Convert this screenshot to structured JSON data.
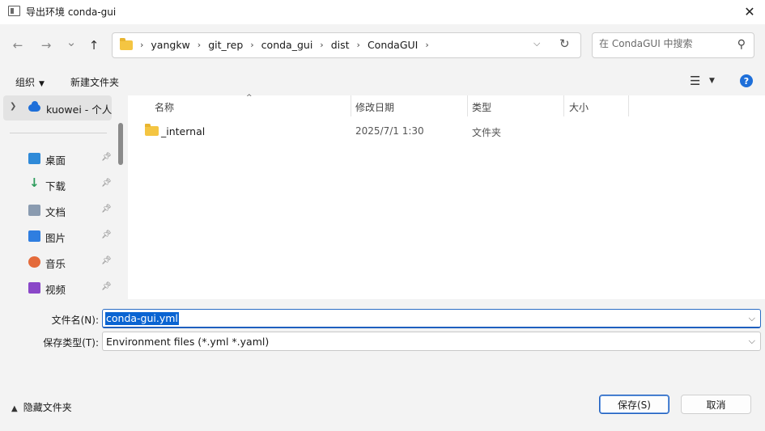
{
  "window": {
    "title": "导出环境 conda-gui",
    "close_glyph": "✕"
  },
  "nav": {
    "back_glyph": "←",
    "forward_glyph": "→",
    "recent_glyph": "⌄",
    "up_glyph": "↑",
    "breadcrumbs": [
      "yangkw",
      "git_rep",
      "conda_gui",
      "dist",
      "CondaGUI"
    ],
    "separator": "›",
    "search_placeholder": "在 CondaGUI 中搜索"
  },
  "commands": {
    "organize": "组织",
    "new_folder": "新建文件夹",
    "help_glyph": "?"
  },
  "sidebar": {
    "root_label": "kuowei - 个人",
    "items": [
      {
        "label": "桌面",
        "icon": "desktop-icon"
      },
      {
        "label": "下载",
        "icon": "download-icon"
      },
      {
        "label": "文档",
        "icon": "documents-icon"
      },
      {
        "label": "图片",
        "icon": "pictures-icon"
      },
      {
        "label": "音乐",
        "icon": "music-icon"
      },
      {
        "label": "视频",
        "icon": "videos-icon"
      }
    ]
  },
  "filelist": {
    "columns": {
      "name": "名称",
      "date": "修改日期",
      "type": "类型",
      "size": "大小"
    },
    "rows": [
      {
        "name": "_internal",
        "date": "2025/7/1 1:30",
        "type": "文件夹",
        "size": ""
      }
    ]
  },
  "save": {
    "filename_label": "文件名(N):",
    "filename_value": "conda-gui.yml",
    "filetype_label": "保存类型(T):",
    "filetype_value": "Environment files (*.yml *.yaml)",
    "hide_folders": "隐藏文件夹",
    "save_button": "保存(S)",
    "cancel_button": "取消"
  },
  "colors": {
    "accent": "#1e5fbf",
    "selection": "#0a64d2",
    "panel": "#f3f3f3",
    "folder": "#f4c542"
  }
}
